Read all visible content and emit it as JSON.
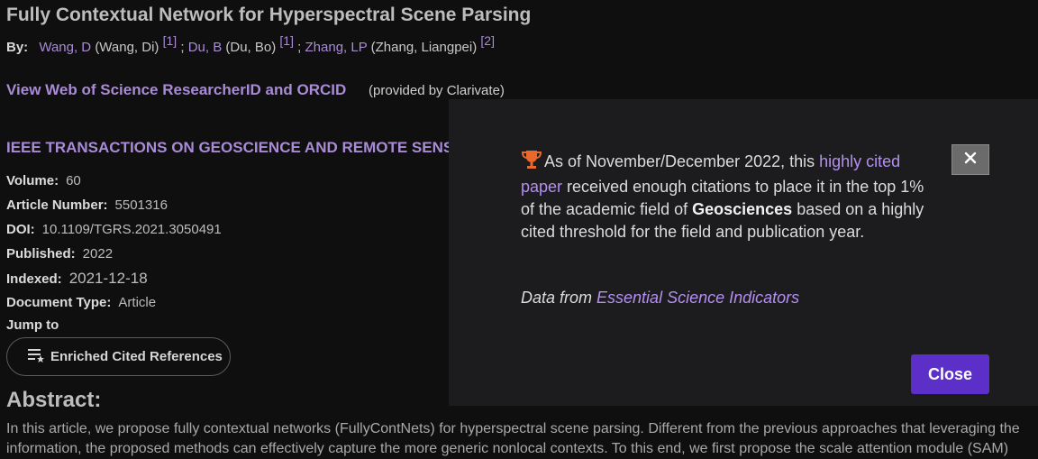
{
  "record": {
    "title": "Fully Contextual Network for Hyperspectral Scene Parsing",
    "by_label": "By:",
    "authors": [
      {
        "short": "Wang, D",
        "full": "(Wang, Di)",
        "ref": "[1]",
        "sep": ";"
      },
      {
        "short": "Du, B",
        "full": "(Du, Bo)",
        "ref": "[1]",
        "sep": ";"
      },
      {
        "short": "Zhang, LP",
        "full": "(Zhang, Liangpei)",
        "ref": "[2]",
        "sep": ""
      }
    ],
    "researcher_link": "View Web of Science ResearcherID and ORCID",
    "provided_by": "(provided by Clarivate)",
    "journal": "IEEE TRANSACTIONS ON GEOSCIENCE AND REMOTE SENSI",
    "fields": [
      {
        "label": "Volume:",
        "value": "60"
      },
      {
        "label": "Article Number:",
        "value": "5501316"
      },
      {
        "label": "DOI:",
        "value": "10.1109/TGRS.2021.3050491"
      },
      {
        "label": "Published:",
        "value": "2022"
      },
      {
        "label": "Indexed:",
        "value": "2021-12-18"
      },
      {
        "label": "Document Type:",
        "value": "Article"
      }
    ],
    "jump_to": "Jump to",
    "enriched_refs_button": "Enriched Cited References",
    "abstract_heading": "Abstract:",
    "abstract_line1": "In this article, we propose fully contextual networks (FullyContNets) for hyperspectral scene parsing. Different from the previous approaches that leveraging the",
    "abstract_line2": "information, the proposed methods can effectively capture the more generic nonlocal contexts. To this end, we first propose the scale attention module (SAM)"
  },
  "modal": {
    "text_1": "As of November/December 2022, this ",
    "link_1": "highly cited paper",
    "text_2": " received enough citations to place it in the top 1% of the academic field of ",
    "field": "Geosciences",
    "text_3": " based on a highly cited threshold for the field and publication year.",
    "source_prefix": "Data from ",
    "source_link": "Essential Science Indicators",
    "close_label": "Close",
    "icons": {
      "trophy": "trophy-icon",
      "close": "close-icon"
    },
    "accent": "#5b2fc8",
    "link_color": "#b48ff0"
  }
}
